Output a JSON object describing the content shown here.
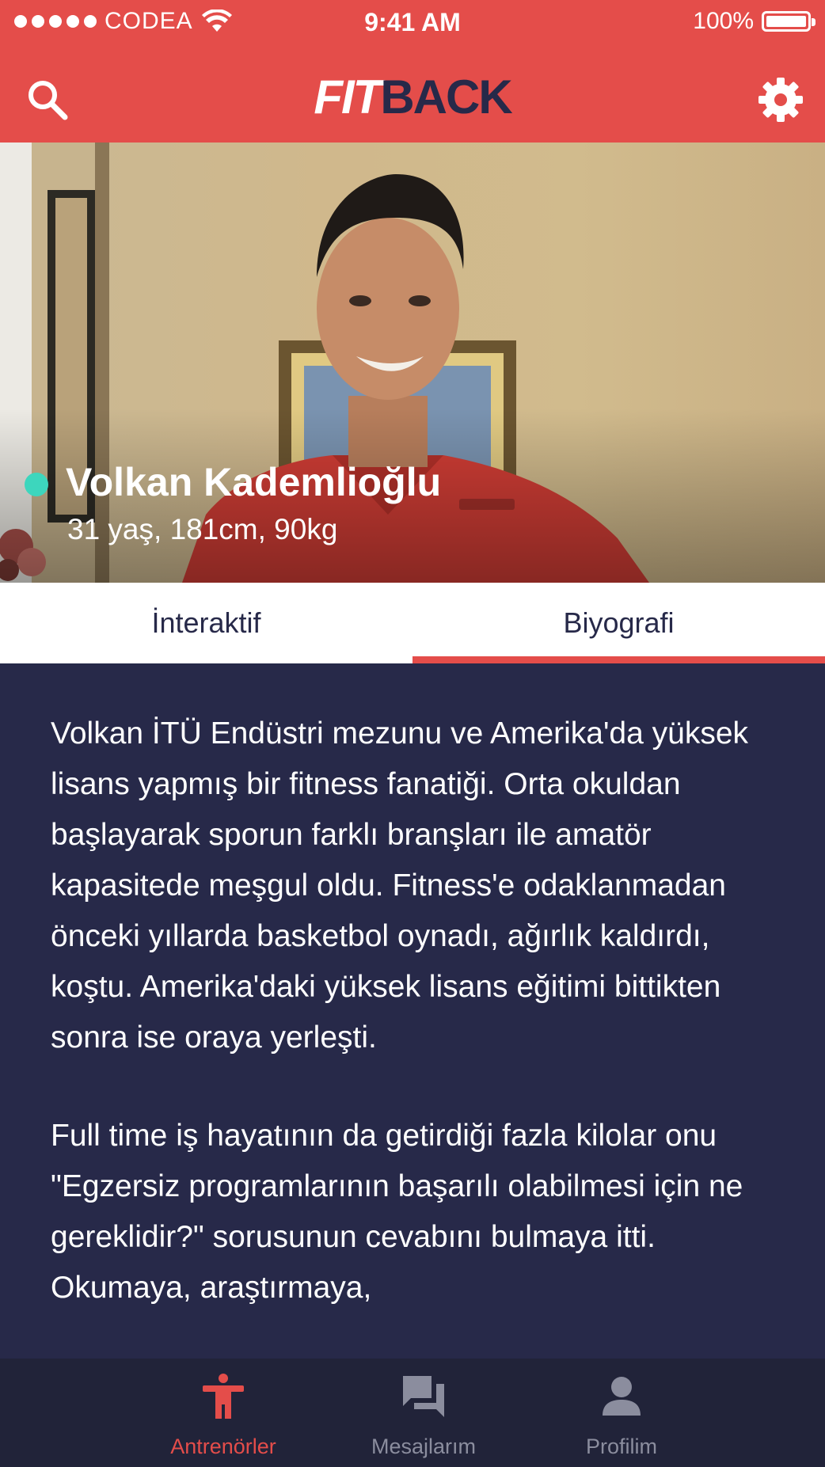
{
  "status_bar": {
    "carrier": "CODEA",
    "time": "9:41 AM",
    "battery": "100%"
  },
  "header": {
    "logo_fit": "FIT",
    "logo_back": "BACK",
    "search_icon": "search-icon",
    "settings_icon": "gear-icon"
  },
  "profile": {
    "name": "Volkan Kademlioğlu",
    "stats": "31 yaş, 181cm, 90kg",
    "online": true
  },
  "tabs": [
    {
      "label": "İnteraktif",
      "active": false
    },
    {
      "label": "Biyografi",
      "active": true
    }
  ],
  "bio": {
    "paragraph1": "Volkan İTÜ Endüstri mezunu ve Amerika'da yüksek lisans yapmış bir fitness fanatiği. Orta okuldan başlayarak sporun farklı branşları ile amatör kapasitede meşgul oldu. Fitness'e odaklanmadan önceki yıllarda basketbol oynadı, ağırlık kaldırdı, koştu. Amerika'daki yüksek lisans eğitimi bittikten sonra ise oraya yerleşti.",
    "paragraph2": "Full time iş hayatının da getirdiği fazla kilolar onu \"Egzersiz programlarının başarılı olabilmesi için ne gereklidir?\" sorusunun cevabını bulmaya itti. Okumaya, araştırmaya,"
  },
  "bottom_nav": [
    {
      "label": "Antrenörler",
      "icon": "trainer-icon",
      "active": true
    },
    {
      "label": "Mesajlarım",
      "icon": "messages-icon",
      "active": false
    },
    {
      "label": "Profilim",
      "icon": "profile-icon",
      "active": false
    }
  ],
  "colors": {
    "brand_red": "#E44D4A",
    "navy": "#272949",
    "online_green": "#3DD6BD",
    "inactive_gray": "#8B8D9E"
  }
}
